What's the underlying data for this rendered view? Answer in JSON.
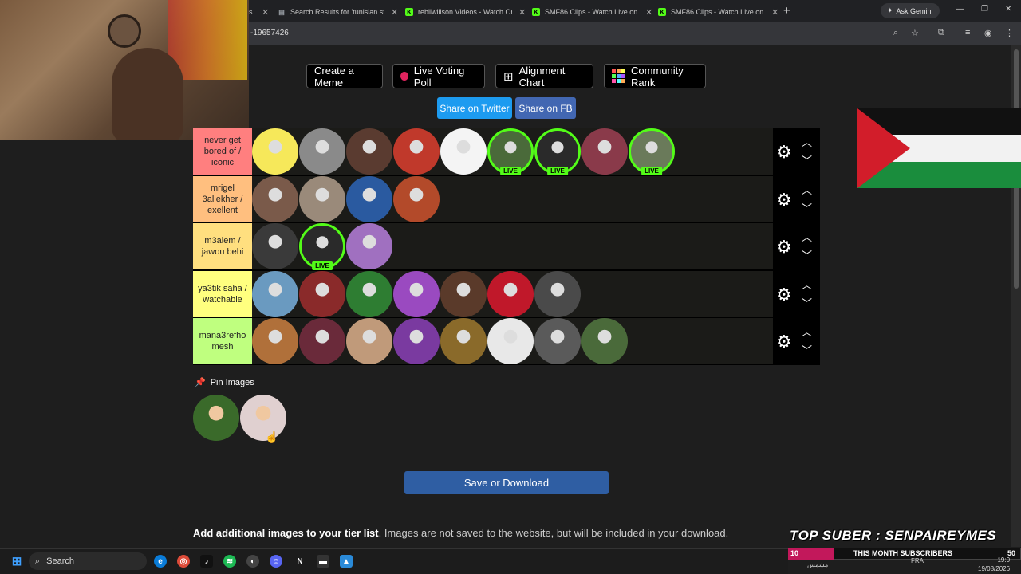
{
  "browser": {
    "tabs": [
      {
        "label": "s",
        "fav_color": "#888",
        "fav_glyph": ""
      },
      {
        "label": "Search Results for 'tunisian stre",
        "fav_color": "#9aa0a6",
        "fav_glyph": "▤"
      },
      {
        "label": "rebiiwillson Videos - Watch On",
        "fav_color": "#53fc18",
        "fav_glyph": "K"
      },
      {
        "label": "SMF86 Clips - Watch Live on Ki",
        "fav_color": "#53fc18",
        "fav_glyph": "K"
      },
      {
        "label": "SMF86 Clips - Watch Live on Ki",
        "fav_color": "#53fc18",
        "fav_glyph": "K"
      }
    ],
    "new_tab": "+",
    "gemini_label": "Ask Gemini",
    "url": "-19657426",
    "icons": [
      "zoom-icon",
      "star-icon",
      "extensions-icon",
      "media-icon",
      "profile-icon",
      "menu-icon"
    ]
  },
  "toolbar": {
    "create_meme": "Create a Meme",
    "live_voting": "Live Voting Poll",
    "alignment_chart": "Alignment Chart",
    "community_rank": "Community Rank",
    "share_twitter": "Share on Twitter",
    "share_fb": "Share on FB"
  },
  "tiers": [
    {
      "label": "never get bored of / iconic",
      "color": "#ff7f7f",
      "items": [
        {
          "bg": "#f6e85a",
          "live": false
        },
        {
          "bg": "#8a8a8a",
          "live": false
        },
        {
          "bg": "#5a3b30",
          "live": false
        },
        {
          "bg": "#c0392b",
          "live": false
        },
        {
          "bg": "#f4f4f4",
          "live": false
        },
        {
          "bg": "#4a6a3a",
          "live": true
        },
        {
          "bg": "#2a2a2a",
          "live": true
        },
        {
          "bg": "#8a3a4a",
          "live": false
        },
        {
          "bg": "#6a7a5a",
          "live": true
        }
      ]
    },
    {
      "label": "mrigel 3allekher / exellent",
      "color": "#ffbf7f",
      "items": [
        {
          "bg": "#7a5a4a",
          "live": false
        },
        {
          "bg": "#9a8a7a",
          "live": false
        },
        {
          "bg": "#2a5aa0",
          "live": false
        },
        {
          "bg": "#b34a2a",
          "live": false
        }
      ]
    },
    {
      "label": "m3alem / jawou behi",
      "color": "#ffdf7f",
      "items": [
        {
          "bg": "#3a3a3a",
          "live": false
        },
        {
          "bg": "#2a2a2a",
          "live": true
        },
        {
          "bg": "#a070c0",
          "live": false
        }
      ]
    },
    {
      "label": "ya3tik saha / watchable",
      "color": "#ffff7f",
      "items": [
        {
          "bg": "#6a9ac0",
          "live": false
        },
        {
          "bg": "#8a2a2a",
          "live": false
        },
        {
          "bg": "#2e7d32",
          "live": false
        },
        {
          "bg": "#9a4ac0",
          "live": false
        },
        {
          "bg": "#5a3a2a",
          "live": false
        },
        {
          "bg": "#c0182a",
          "live": false
        },
        {
          "bg": "#4a4a4a",
          "live": false
        }
      ]
    },
    {
      "label": "mana3refho mesh",
      "color": "#bfff7f",
      "items": [
        {
          "bg": "#b0703a",
          "live": false
        },
        {
          "bg": "#6a2a3a",
          "live": false
        },
        {
          "bg": "#c09a7a",
          "live": false
        },
        {
          "bg": "#7a3aa0",
          "live": false
        },
        {
          "bg": "#8a6a2a",
          "live": false
        },
        {
          "bg": "#e8e8e8",
          "live": false
        },
        {
          "bg": "#5a5a5a",
          "live": false
        },
        {
          "bg": "#4a6a3a",
          "live": false
        }
      ]
    }
  ],
  "live_badge": "LIVE",
  "pin": {
    "label": "Pin Images",
    "items": [
      {
        "bg": "#3a6a2a"
      },
      {
        "bg": "#e0d0d0"
      }
    ]
  },
  "save_label": "Save or Download",
  "add_images": {
    "bold": "Add additional images to your tier list",
    "rest": ". Images are not saved to the website, but will be included in your download."
  },
  "overlay": {
    "top_suber": "TOP SUBER : SENPAIREYMES",
    "sub_count": "10",
    "sub_title": "THIS MONTH SUBSCRIBERS",
    "sub_goal": "50",
    "sub_progress": 0.2
  },
  "taskbar": {
    "search_placeholder": "Search",
    "tray_text": "مشمس",
    "lang": "FRA",
    "time": "19:0",
    "date": "19/08/2026"
  }
}
